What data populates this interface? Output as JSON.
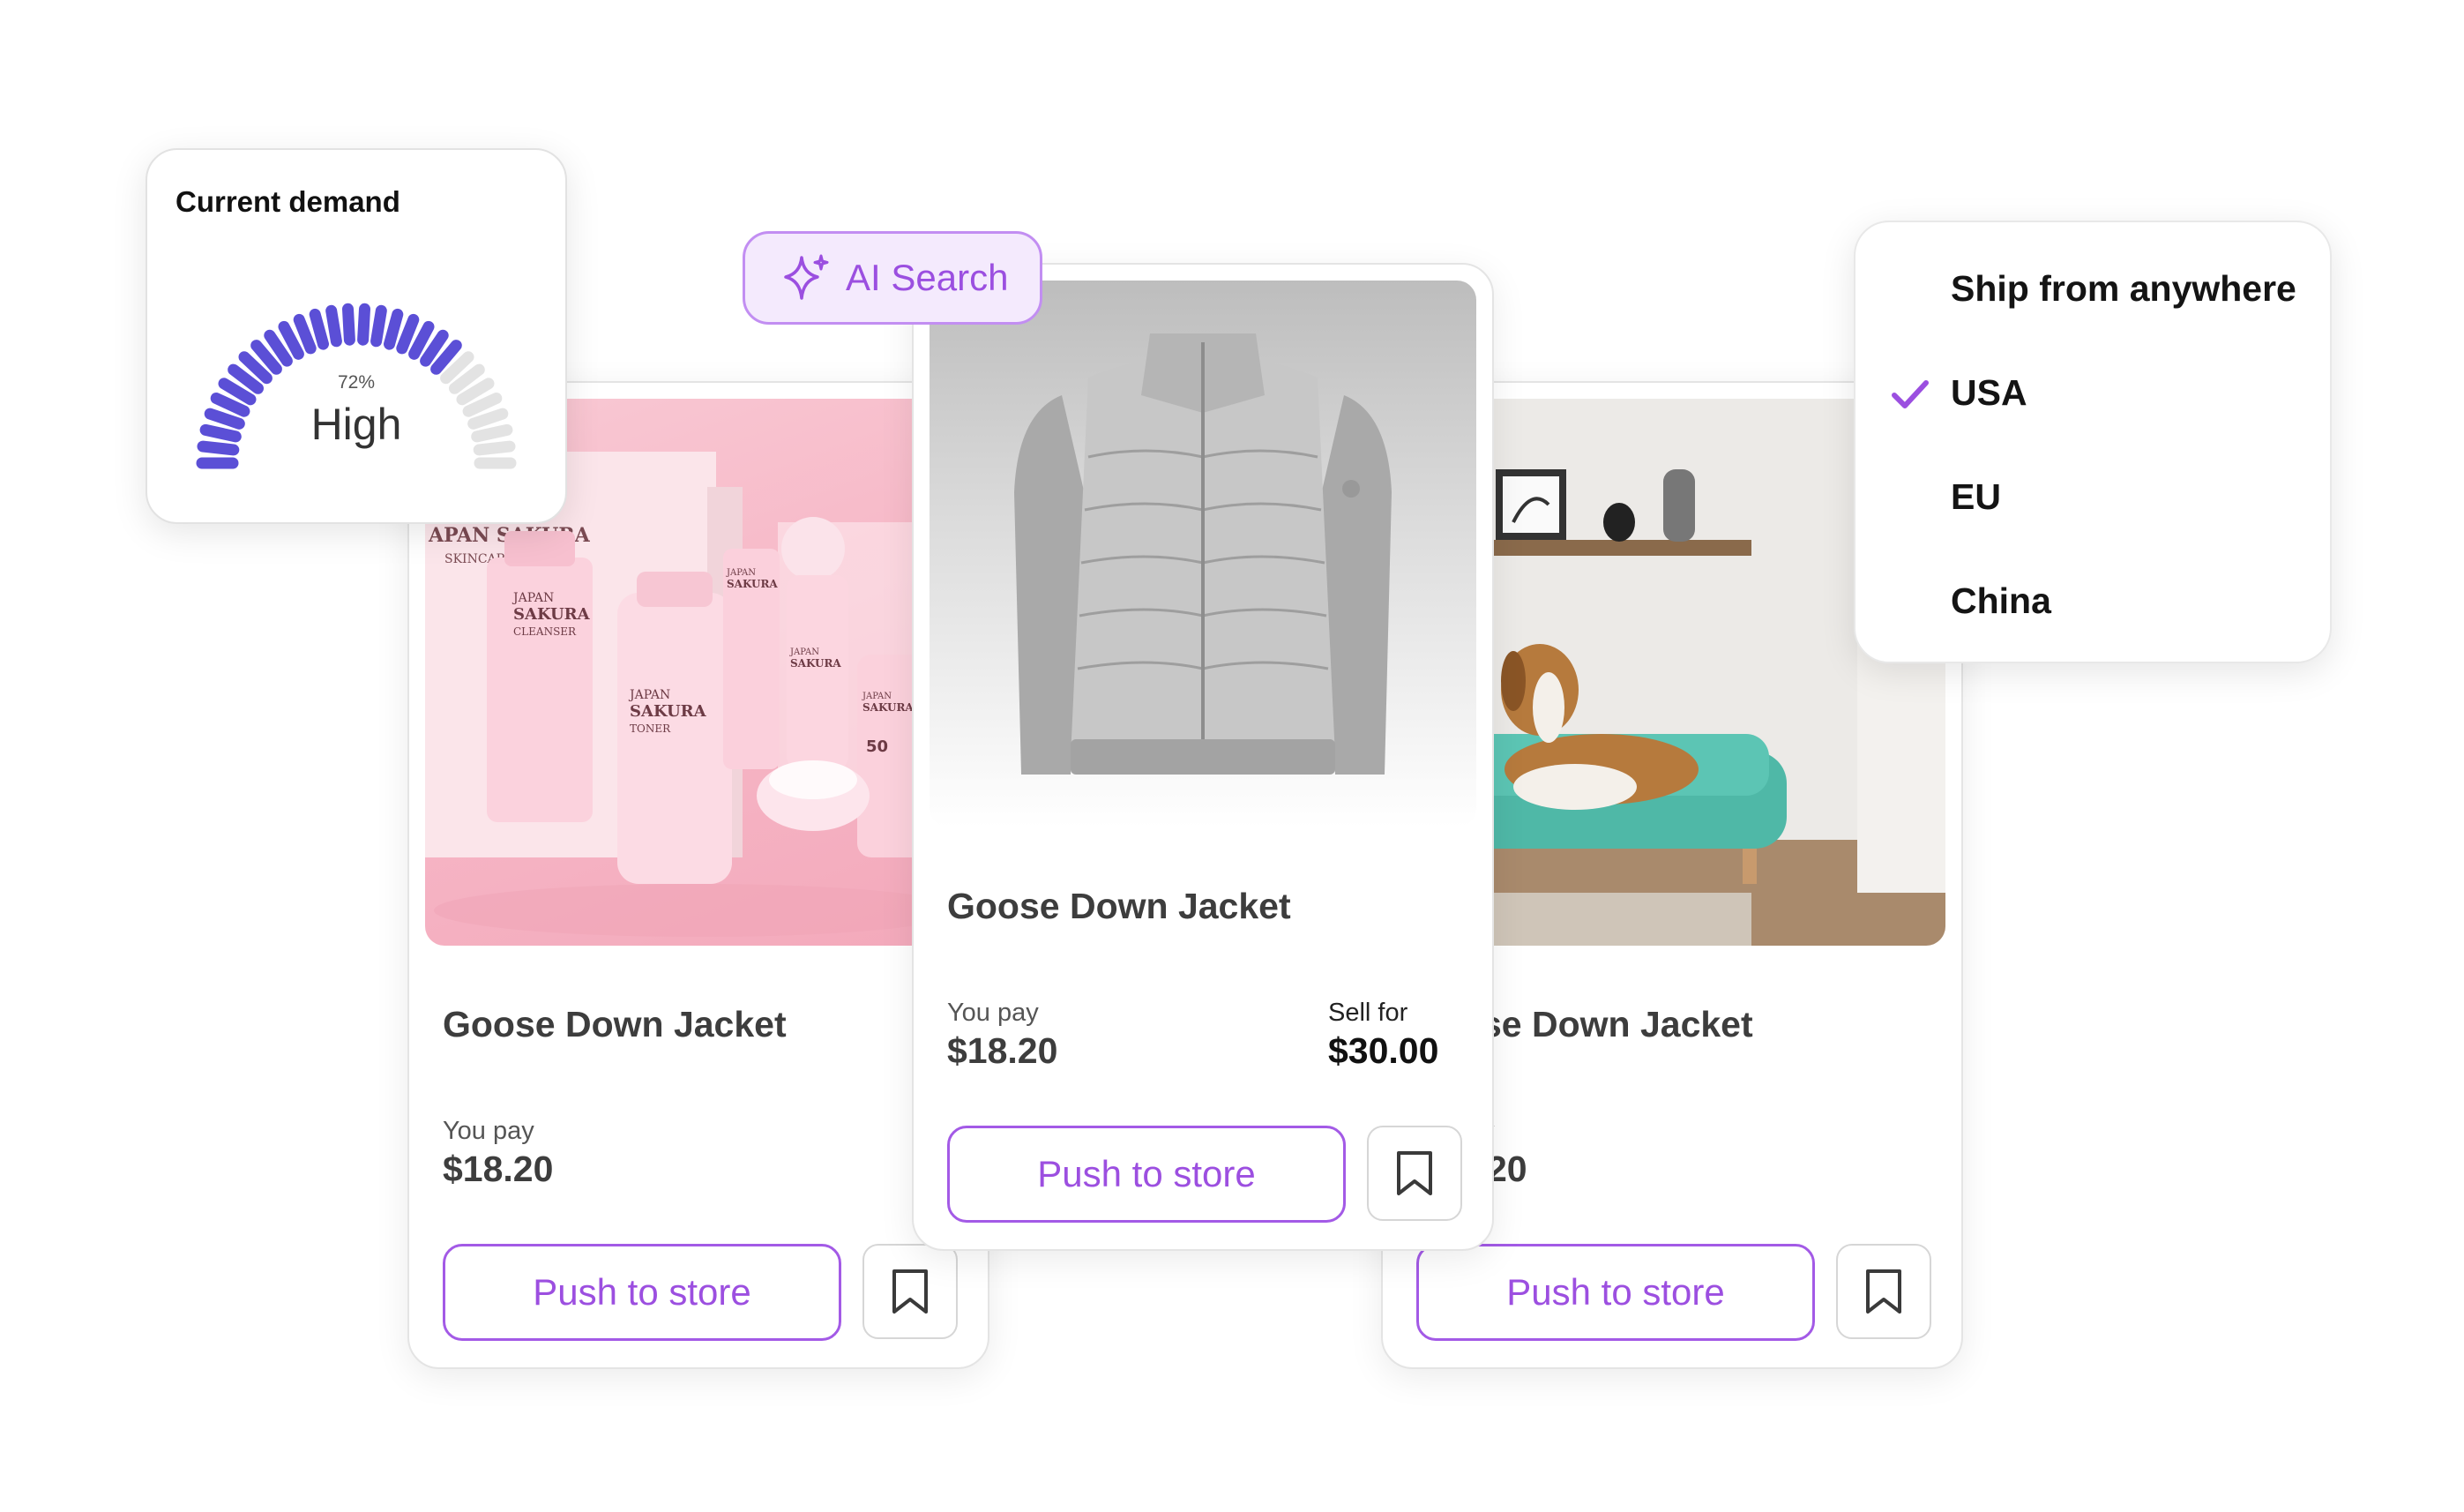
{
  "demand": {
    "title": "Current demand",
    "percent": 72,
    "percent_label": "72%",
    "level": "High",
    "active_color": "#5b4fd6",
    "inactive_color": "#e3e3e3"
  },
  "ai_search": {
    "label": "AI Search",
    "icon": "sparkle-icon"
  },
  "ship_from": {
    "options": [
      {
        "label": "Ship from anywhere",
        "selected": false
      },
      {
        "label": "USA",
        "selected": true
      },
      {
        "label": "EU",
        "selected": false
      },
      {
        "label": "China",
        "selected": false
      }
    ],
    "check_color": "#9b4fe0"
  },
  "cards": {
    "left": {
      "title": "Goose Down Jacket",
      "you_pay_label": "You pay",
      "you_pay": "$18.20",
      "push_label": "Push to store",
      "image": "cosmetics-photo",
      "product_texts": [
        "APAN SAKURA",
        "SKINCARE SET",
        "JAPAN",
        "SAKURA",
        "CLEANSER",
        "JAPAN",
        "SAKURA",
        "TONER",
        "JAPAN",
        "SAKURA",
        "JAPAN",
        "SAKURA",
        "JAPAN",
        "SAKURA",
        "50"
      ]
    },
    "center": {
      "title": "Goose Down Jacket",
      "you_pay_label": "You pay",
      "you_pay": "$18.20",
      "sell_for_label": "Sell for",
      "sell_for": "$30.00",
      "push_label": "Push to store",
      "image": "jacket-photo"
    },
    "right": {
      "title": "se Down Jacket",
      "you_pay_label": "y",
      "you_pay": "20",
      "push_label": "Push to store",
      "image": "dog-sofa-photo"
    }
  },
  "accent_color": "#9b4fe0"
}
